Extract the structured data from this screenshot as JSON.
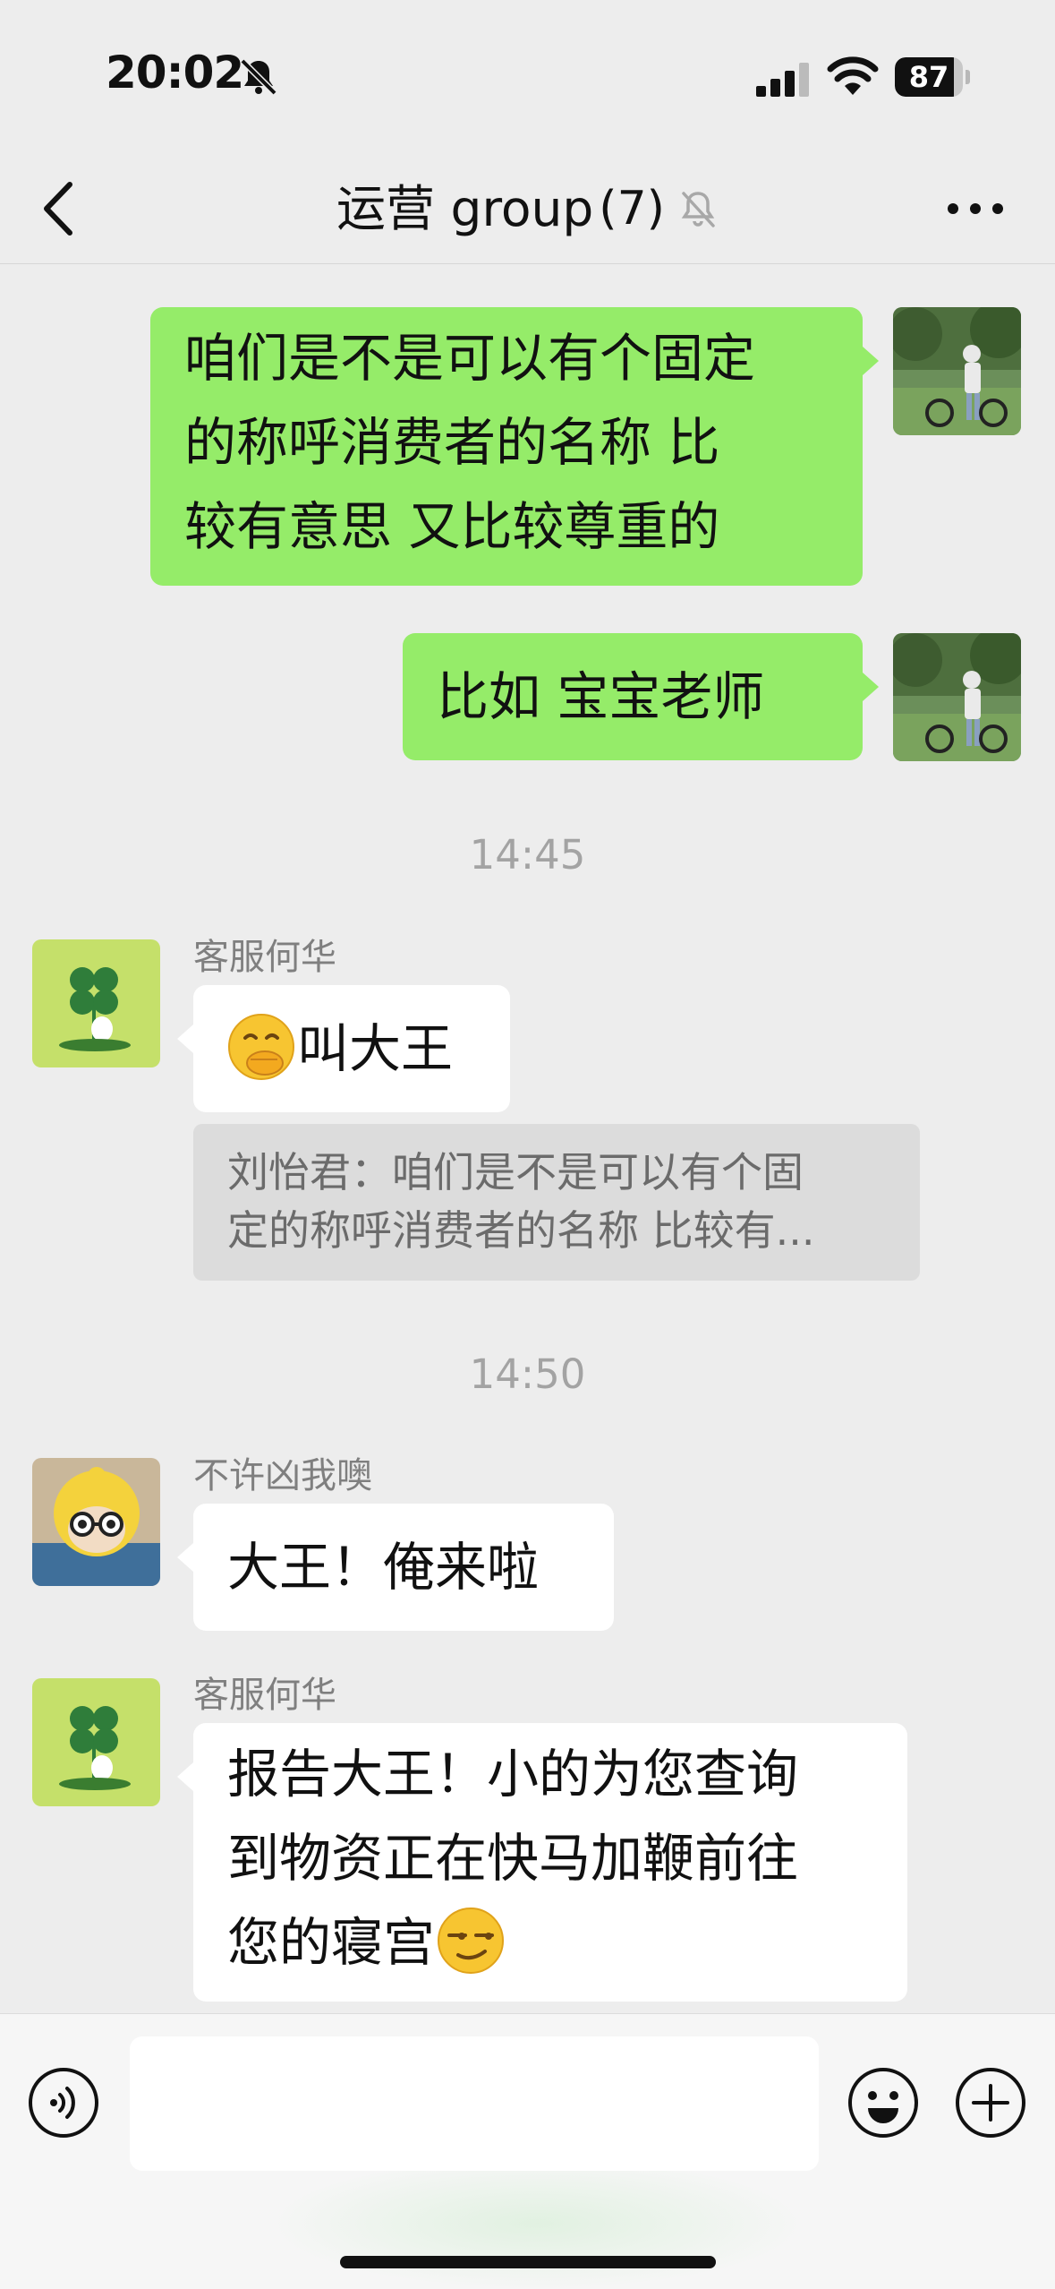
{
  "status_bar": {
    "time": "20:02",
    "battery_level": "87",
    "battery_fraction": 0.87
  },
  "nav": {
    "title": "运营 group",
    "member_count": "(7)"
  },
  "messages": {
    "m1": {
      "lines": [
        "咱们是不是可以有个固定",
        "的称呼消费者的名称  比",
        "较有意思 又比较尊重的"
      ]
    },
    "m2": {
      "text": "比如  宝宝老师"
    },
    "t1": "14:45",
    "m3": {
      "sender": "客服何华",
      "text": "叫大王",
      "quote_lines": [
        "刘怡君：咱们是不是可以有个固",
        "定的称呼消费者的名称  比较有..."
      ]
    },
    "t2": "14:50",
    "m4": {
      "sender": "不许凶我噢",
      "text": "大王！俺来啦"
    },
    "m5": {
      "sender": "客服何华",
      "lines": [
        "报告大王！小的为您查询",
        "到物资正在快马加鞭前往",
        "您的寝宫"
      ]
    }
  },
  "input": {
    "placeholder": ""
  },
  "colors": {
    "background": "#ededed",
    "my_bubble": "#95ec69",
    "their_bubble": "#ffffff",
    "quote_bg": "#dcdcdc"
  },
  "icons": {
    "back": "chevron-left-icon",
    "mute": "bell-slash-icon",
    "more": "ellipsis-icon",
    "voice": "voice-icon",
    "emoji": "smiley-icon",
    "plus": "plus-circle-icon"
  }
}
